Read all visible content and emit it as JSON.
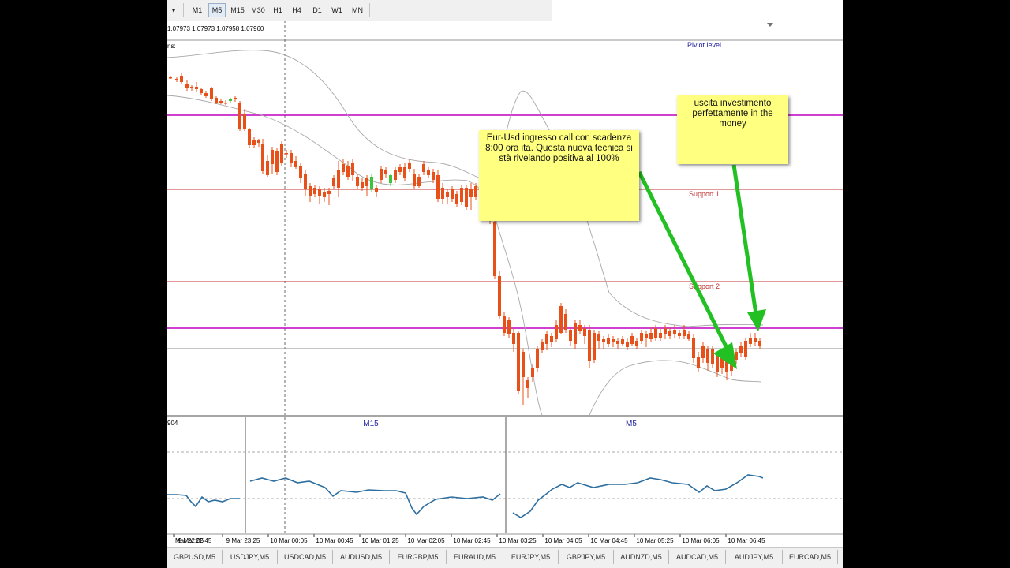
{
  "toolbar": {
    "timeframes": [
      "M1",
      "M5",
      "M15",
      "M30",
      "H1",
      "H4",
      "D1",
      "W1",
      "MN"
    ],
    "active": "M5"
  },
  "chart": {
    "ohlc_line": "1.07973 1.07973 1.07958 1.07960",
    "indicator_label": "ns:",
    "levels": {
      "pivot_label": "Piviot level",
      "support1_label": "Support 1",
      "support2_label": "Support 2"
    },
    "colors": {
      "bull": "#3cc43c",
      "bear": "#e8501a",
      "pivot": "#c000c0",
      "support": "#c03030",
      "annotation_arrow": "#22c022",
      "sticky_note": "#ffff80"
    }
  },
  "notes": {
    "entry": "Eur-Usd ingresso call con scadenza 8:00 ora ita. Questa nuova tecnica si stà rivelando positiva al 100%",
    "exit": "uscita investimento perfettamente in the money"
  },
  "indicator": {
    "left_value": "904",
    "panel_labels": [
      "M15",
      "M5"
    ]
  },
  "time_axis": [
    "Mar 22:05",
    "9 Mar 22:45",
    "9 Mar 23:25",
    "10 Mar 00:05",
    "10 Mar 00:45",
    "10 Mar 01:25",
    "10 Mar 02:05",
    "10 Mar 02:45",
    "10 Mar 03:25",
    "10 Mar 04:05",
    "10 Mar 04:45",
    "10 Mar 05:25",
    "10 Mar 06:05",
    "10 Mar 06:45"
  ],
  "tabs": [
    "GBPUSD,M5",
    "USDJPY,M5",
    "USDCAD,M5",
    "AUDUSD,M5",
    "EURGBP,M5",
    "EURAUD,M5",
    "EURJPY,M5",
    "GBPJPY,M5",
    "AUDNZD,M5",
    "AUDCAD,M5",
    "AUDJPY,M5",
    "EURCAD,M5"
  ]
}
